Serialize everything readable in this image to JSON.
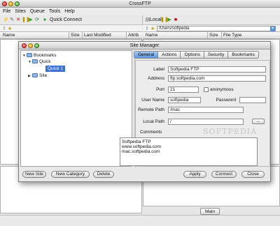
{
  "app": {
    "title": "CrossFTP"
  },
  "menu": [
    "File",
    "Sites",
    "Queue",
    "Tools",
    "Help"
  ],
  "toolbar": {
    "quick_connect": "Quick Connect"
  },
  "local": {
    "label": "Local",
    "path": "/Users/softpedia"
  },
  "remote_columns": [
    "Name",
    "Size",
    "Last Modified",
    "Attrib"
  ],
  "local_columns": [
    "Name",
    "Size",
    "File Type"
  ],
  "bottom": {
    "main_tab": "Main"
  },
  "site_manager": {
    "title": "Site Manager",
    "tree": {
      "root": "Bookmarks",
      "group_quick": "Quick",
      "item_quick1": "Quick 1",
      "group_site": "Site"
    },
    "tabs": [
      "General",
      "Actions",
      "Options",
      "Security",
      "Bookmarks"
    ],
    "form": {
      "label_label": "Label",
      "label_value": "Softpedia FTP",
      "address_label": "Address",
      "address_value": "ftp.softpedia.com",
      "port_label": "Port",
      "port_value": "21",
      "anonymous_label": "anonymous",
      "username_label": "User Name",
      "username_value": "softpedia",
      "password_label": "Password",
      "remote_path_label": "Remote Path",
      "remote_path_value": "/mac",
      "local_path_label": "Local Path",
      "local_path_value": "/",
      "browse_label": "...",
      "comments_label": "Comments",
      "comments_lines": [
        "Softpedia FTP",
        "www.softpedia.com",
        "mac.softpedia.com"
      ]
    },
    "buttons": {
      "new_site": "New Site",
      "new_category": "New Category",
      "delete": "Delete",
      "apply": "Apply",
      "connect": "Connect",
      "close": "Close"
    },
    "watermark": "SOFTPEDIA"
  },
  "colors": {
    "accent": "#3c72d1",
    "tab_active": "#5b95de"
  }
}
